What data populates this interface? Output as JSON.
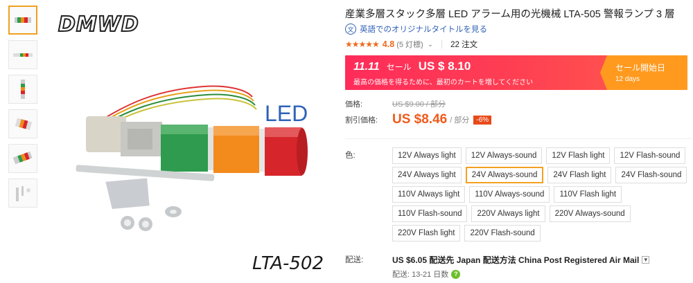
{
  "brand": "DMWD",
  "image_labels": {
    "led": "LED",
    "model": "LTA-502"
  },
  "product": {
    "title": "産業多層スタック多層 LED アラーム用の光機械 LTA-505 警報ランプ 3 層",
    "translate_link": "英語でのオリジナルタイトルを見る",
    "rating": "4.8",
    "rating_count": "(5 灯標)",
    "orders": "22 注文"
  },
  "sale": {
    "badge": "11.11",
    "label": "セール",
    "price": "US $ 8.10",
    "note": "最高の価格を得るために、最初のカートを増してください",
    "start_label": "セール開始日",
    "days": "12 days"
  },
  "pricing": {
    "price_label": "価格:",
    "old_price": "US $9.00 / 部分",
    "discount_label": "割引価格:",
    "new_price": "US $8.46",
    "unit": "/ 部分",
    "discount": "-6%"
  },
  "color": {
    "label": "色:",
    "selected_index": 5,
    "options": [
      "12V Always light",
      "12V Always-sound",
      "12V Flash light",
      "12V Flash-sound",
      "24V Always light",
      "24V Always-sound",
      "24V Flash light",
      "24V Flash-sound",
      "110V Always light",
      "110V Always-sound",
      "110V Flash light",
      "110V Flash-sound",
      "220V Always light",
      "220V Always-sound",
      "220V Flash light",
      "220V Flash-sound"
    ]
  },
  "shipping": {
    "label": "配送:",
    "main": "US $6.05 配送先 Japan 配送方法 China Post Registered Air Mail",
    "sub": "配送: 13-21 日数"
  },
  "colors": {
    "accent": "#f05a1a",
    "sale_bg": "#ff2c5a",
    "sale_right": "#ff9a1f",
    "selected_border": "#f5a020",
    "link": "#2d5fb6"
  }
}
